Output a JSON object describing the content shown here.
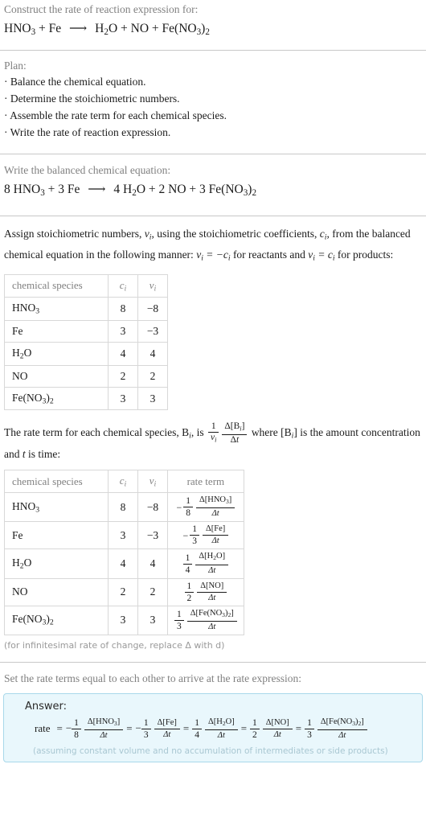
{
  "problem": {
    "prompt": "Construct the rate of reaction expression for:",
    "equation": {
      "reactants": [
        "HNO_3",
        "Fe"
      ],
      "products": [
        "H_2O",
        "NO",
        "Fe(NO_3)_2"
      ],
      "arrow": "⟶"
    }
  },
  "plan": {
    "title": "Plan:",
    "items": [
      "Balance the chemical equation.",
      "Determine the stoichiometric numbers.",
      "Assemble the rate term for each chemical species.",
      "Write the rate of reaction expression."
    ]
  },
  "balanced": {
    "title": "Write the balanced chemical equation:",
    "reactant_coeffs": [
      "8",
      "3"
    ],
    "product_coeffs": [
      "4",
      "2",
      "3"
    ]
  },
  "stoichiometry": {
    "intro_1": "Assign stoichiometric numbers, ",
    "intro_2": ", using the stoichiometric coefficients, ",
    "intro_3": ", from the balanced chemical equation in the following manner: ",
    "intro_4": " for reactants and ",
    "intro_5": " for products:",
    "vi_symbol": "ν",
    "ci_symbol": "c",
    "rel_reactants": "ν_i = −c_i",
    "rel_products": "ν_i = c_i",
    "table": {
      "headers": [
        "chemical species",
        "c_i",
        "ν_i"
      ],
      "rows": [
        {
          "species": "HNO_3",
          "c": "8",
          "v": "−8"
        },
        {
          "species": "Fe",
          "c": "3",
          "v": "−3"
        },
        {
          "species": "H_2O",
          "c": "4",
          "v": "4"
        },
        {
          "species": "NO",
          "c": "2",
          "v": "2"
        },
        {
          "species": "Fe(NO_3)_2",
          "c": "3",
          "v": "3"
        }
      ]
    }
  },
  "rate_terms": {
    "intro_a": "The rate term for each chemical species, B",
    "intro_b": ", is ",
    "intro_c": " where [B",
    "intro_d": "] is the amount concentration and ",
    "intro_e": " is time:",
    "fraction_num": "1",
    "fraction_den": "ν_i",
    "delta_num": "Δ[B_i]",
    "delta_den": "Δt",
    "table": {
      "headers": [
        "chemical species",
        "c_i",
        "ν_i",
        "rate term"
      ],
      "rows": [
        {
          "species": "HNO_3",
          "c": "8",
          "v": "−8",
          "sign": "−",
          "coef": "1",
          "denom": "8",
          "delta": "Δ[HNO_3]",
          "dt": "Δt"
        },
        {
          "species": "Fe",
          "c": "3",
          "v": "−3",
          "sign": "−",
          "coef": "1",
          "denom": "3",
          "delta": "Δ[Fe]",
          "dt": "Δt"
        },
        {
          "species": "H_2O",
          "c": "4",
          "v": "4",
          "sign": "",
          "coef": "1",
          "denom": "4",
          "delta": "Δ[H_2O]",
          "dt": "Δt"
        },
        {
          "species": "NO",
          "c": "2",
          "v": "2",
          "sign": "",
          "coef": "1",
          "denom": "2",
          "delta": "Δ[NO]",
          "dt": "Δt"
        },
        {
          "species": "Fe(NO_3)_2",
          "c": "3",
          "v": "3",
          "sign": "",
          "coef": "1",
          "denom": "3",
          "delta": "Δ[Fe(NO_3)_2]",
          "dt": "Δt"
        }
      ]
    },
    "footnote": "(for infinitesimal rate of change, replace Δ with d)"
  },
  "final": {
    "intro": "Set the rate terms equal to each other to arrive at the rate expression:",
    "answer_label": "Answer:",
    "rate_word": "rate",
    "equals": "=",
    "terms": [
      {
        "sign": "−",
        "coef": "1",
        "denom": "8",
        "delta": "Δ[HNO_3]",
        "dt": "Δt"
      },
      {
        "sign": "−",
        "coef": "1",
        "denom": "3",
        "delta": "Δ[Fe]",
        "dt": "Δt"
      },
      {
        "sign": "",
        "coef": "1",
        "denom": "4",
        "delta": "Δ[H_2O]",
        "dt": "Δt"
      },
      {
        "sign": "",
        "coef": "1",
        "denom": "2",
        "delta": "Δ[NO]",
        "dt": "Δt"
      },
      {
        "sign": "",
        "coef": "1",
        "denom": "3",
        "delta": "Δ[Fe(NO_3)_2]",
        "dt": "Δt"
      }
    ],
    "assumption": "(assuming constant volume and no accumulation of intermediates or side products)"
  },
  "colors": {
    "prompt_gray": "#808080",
    "text_black": "#1a1a1a",
    "rule": "#c8c8c8",
    "table_border": "#d8d8d8",
    "answer_bg": "#e9f7fc",
    "answer_border": "#a8d8ea"
  }
}
